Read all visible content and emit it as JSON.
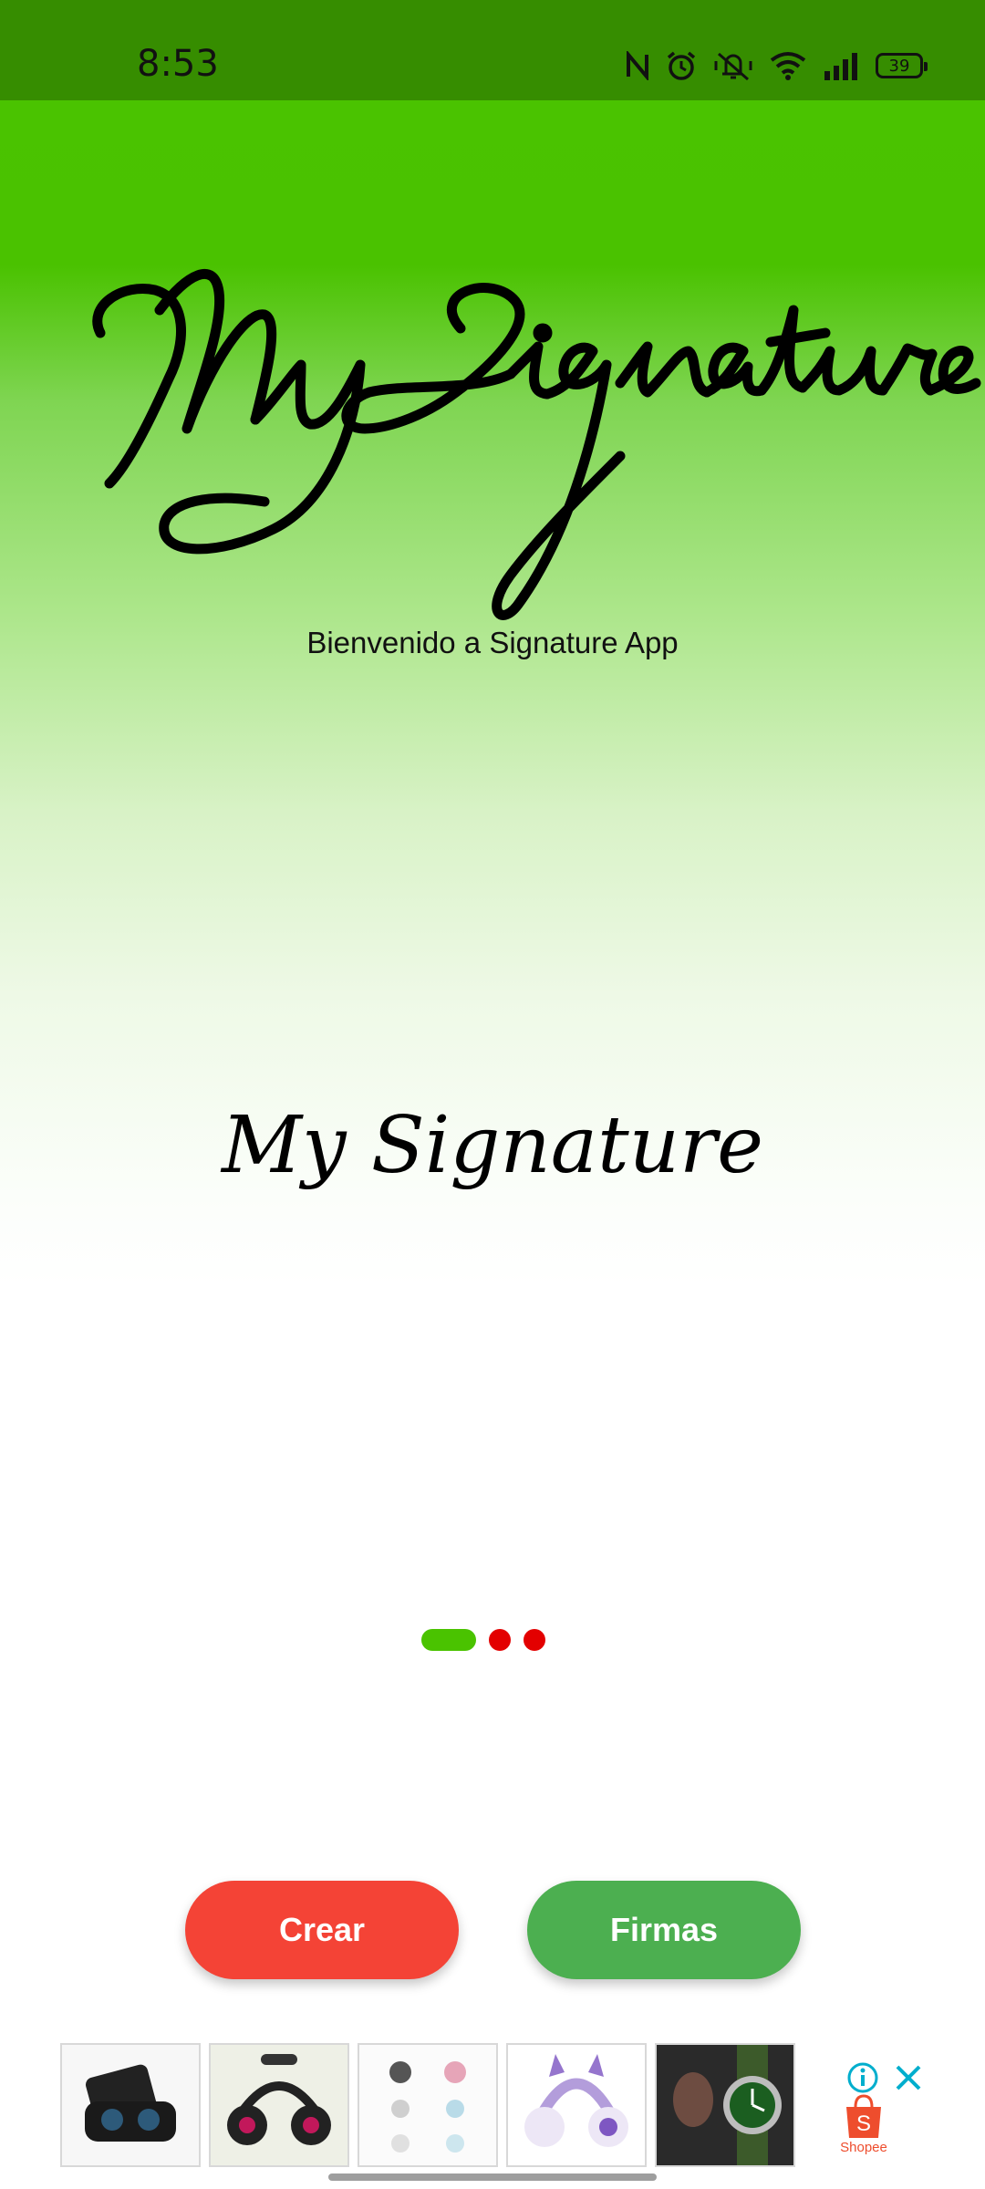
{
  "status_bar": {
    "time": "8:53",
    "battery_level": "39",
    "icons": [
      "nfc-icon",
      "alarm-icon",
      "silent-icon",
      "wifi-icon",
      "signal-icon",
      "battery-icon"
    ]
  },
  "hero": {
    "title_signature": "My Signature",
    "welcome_text": "Bienvenido a Signature App",
    "logo_text": "My Signature"
  },
  "pager": {
    "page_count": 3,
    "active_index": 0,
    "active_color": "#4ac300",
    "inactive_color": "#e30000"
  },
  "buttons": {
    "create_label": "Crear",
    "signatures_label": "Firmas",
    "create_color": "#f44336",
    "signatures_color": "#4caf50"
  },
  "ad": {
    "advertiser": "Shopee",
    "products": [
      "earbuds-case",
      "headphones",
      "cat-ear-headsets",
      "purple-cat-headphones",
      "wristwatch"
    ]
  }
}
